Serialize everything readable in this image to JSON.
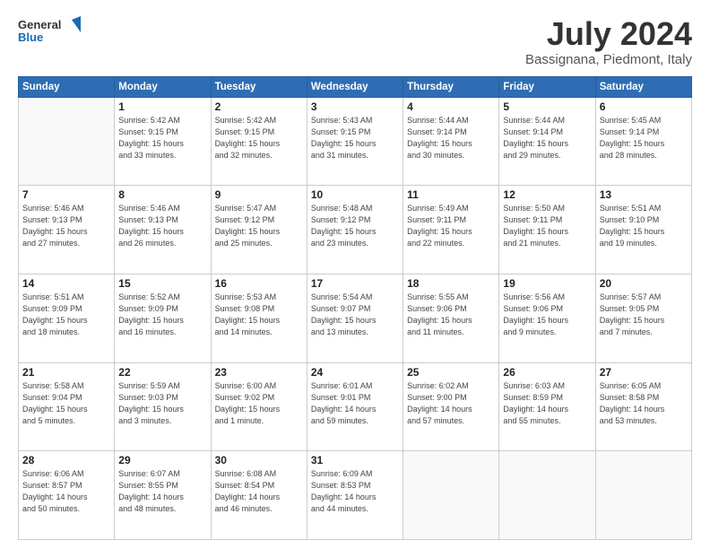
{
  "header": {
    "logo_line1": "General",
    "logo_line2": "Blue",
    "month_year": "July 2024",
    "location": "Bassignana, Piedmont, Italy"
  },
  "weekdays": [
    "Sunday",
    "Monday",
    "Tuesday",
    "Wednesday",
    "Thursday",
    "Friday",
    "Saturday"
  ],
  "weeks": [
    [
      {
        "day": "",
        "info": ""
      },
      {
        "day": "1",
        "info": "Sunrise: 5:42 AM\nSunset: 9:15 PM\nDaylight: 15 hours\nand 33 minutes."
      },
      {
        "day": "2",
        "info": "Sunrise: 5:42 AM\nSunset: 9:15 PM\nDaylight: 15 hours\nand 32 minutes."
      },
      {
        "day": "3",
        "info": "Sunrise: 5:43 AM\nSunset: 9:15 PM\nDaylight: 15 hours\nand 31 minutes."
      },
      {
        "day": "4",
        "info": "Sunrise: 5:44 AM\nSunset: 9:14 PM\nDaylight: 15 hours\nand 30 minutes."
      },
      {
        "day": "5",
        "info": "Sunrise: 5:44 AM\nSunset: 9:14 PM\nDaylight: 15 hours\nand 29 minutes."
      },
      {
        "day": "6",
        "info": "Sunrise: 5:45 AM\nSunset: 9:14 PM\nDaylight: 15 hours\nand 28 minutes."
      }
    ],
    [
      {
        "day": "7",
        "info": "Sunrise: 5:46 AM\nSunset: 9:13 PM\nDaylight: 15 hours\nand 27 minutes."
      },
      {
        "day": "8",
        "info": "Sunrise: 5:46 AM\nSunset: 9:13 PM\nDaylight: 15 hours\nand 26 minutes."
      },
      {
        "day": "9",
        "info": "Sunrise: 5:47 AM\nSunset: 9:12 PM\nDaylight: 15 hours\nand 25 minutes."
      },
      {
        "day": "10",
        "info": "Sunrise: 5:48 AM\nSunset: 9:12 PM\nDaylight: 15 hours\nand 23 minutes."
      },
      {
        "day": "11",
        "info": "Sunrise: 5:49 AM\nSunset: 9:11 PM\nDaylight: 15 hours\nand 22 minutes."
      },
      {
        "day": "12",
        "info": "Sunrise: 5:50 AM\nSunset: 9:11 PM\nDaylight: 15 hours\nand 21 minutes."
      },
      {
        "day": "13",
        "info": "Sunrise: 5:51 AM\nSunset: 9:10 PM\nDaylight: 15 hours\nand 19 minutes."
      }
    ],
    [
      {
        "day": "14",
        "info": "Sunrise: 5:51 AM\nSunset: 9:09 PM\nDaylight: 15 hours\nand 18 minutes."
      },
      {
        "day": "15",
        "info": "Sunrise: 5:52 AM\nSunset: 9:09 PM\nDaylight: 15 hours\nand 16 minutes."
      },
      {
        "day": "16",
        "info": "Sunrise: 5:53 AM\nSunset: 9:08 PM\nDaylight: 15 hours\nand 14 minutes."
      },
      {
        "day": "17",
        "info": "Sunrise: 5:54 AM\nSunset: 9:07 PM\nDaylight: 15 hours\nand 13 minutes."
      },
      {
        "day": "18",
        "info": "Sunrise: 5:55 AM\nSunset: 9:06 PM\nDaylight: 15 hours\nand 11 minutes."
      },
      {
        "day": "19",
        "info": "Sunrise: 5:56 AM\nSunset: 9:06 PM\nDaylight: 15 hours\nand 9 minutes."
      },
      {
        "day": "20",
        "info": "Sunrise: 5:57 AM\nSunset: 9:05 PM\nDaylight: 15 hours\nand 7 minutes."
      }
    ],
    [
      {
        "day": "21",
        "info": "Sunrise: 5:58 AM\nSunset: 9:04 PM\nDaylight: 15 hours\nand 5 minutes."
      },
      {
        "day": "22",
        "info": "Sunrise: 5:59 AM\nSunset: 9:03 PM\nDaylight: 15 hours\nand 3 minutes."
      },
      {
        "day": "23",
        "info": "Sunrise: 6:00 AM\nSunset: 9:02 PM\nDaylight: 15 hours\nand 1 minute."
      },
      {
        "day": "24",
        "info": "Sunrise: 6:01 AM\nSunset: 9:01 PM\nDaylight: 14 hours\nand 59 minutes."
      },
      {
        "day": "25",
        "info": "Sunrise: 6:02 AM\nSunset: 9:00 PM\nDaylight: 14 hours\nand 57 minutes."
      },
      {
        "day": "26",
        "info": "Sunrise: 6:03 AM\nSunset: 8:59 PM\nDaylight: 14 hours\nand 55 minutes."
      },
      {
        "day": "27",
        "info": "Sunrise: 6:05 AM\nSunset: 8:58 PM\nDaylight: 14 hours\nand 53 minutes."
      }
    ],
    [
      {
        "day": "28",
        "info": "Sunrise: 6:06 AM\nSunset: 8:57 PM\nDaylight: 14 hours\nand 50 minutes."
      },
      {
        "day": "29",
        "info": "Sunrise: 6:07 AM\nSunset: 8:55 PM\nDaylight: 14 hours\nand 48 minutes."
      },
      {
        "day": "30",
        "info": "Sunrise: 6:08 AM\nSunset: 8:54 PM\nDaylight: 14 hours\nand 46 minutes."
      },
      {
        "day": "31",
        "info": "Sunrise: 6:09 AM\nSunset: 8:53 PM\nDaylight: 14 hours\nand 44 minutes."
      },
      {
        "day": "",
        "info": ""
      },
      {
        "day": "",
        "info": ""
      },
      {
        "day": "",
        "info": ""
      }
    ]
  ]
}
